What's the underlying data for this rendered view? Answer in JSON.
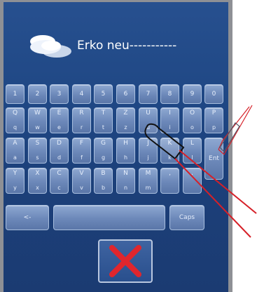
{
  "title": "Erko neu-----------",
  "keyboard": {
    "row_numbers": [
      "1",
      "2",
      "3",
      "4",
      "5",
      "6",
      "7",
      "8",
      "9",
      "0"
    ],
    "row_qwertz": [
      {
        "u": "Q",
        "l": "q"
      },
      {
        "u": "W",
        "l": "w"
      },
      {
        "u": "E",
        "l": "e"
      },
      {
        "u": "R",
        "l": "r"
      },
      {
        "u": "T",
        "l": "t"
      },
      {
        "u": "Z",
        "l": "z"
      },
      {
        "u": "U",
        "l": "u"
      },
      {
        "u": "I",
        "l": "i"
      },
      {
        "u": "O",
        "l": "o"
      },
      {
        "u": "P",
        "l": "p"
      }
    ],
    "row_asdf": [
      {
        "u": "A",
        "l": "a"
      },
      {
        "u": "S",
        "l": "s"
      },
      {
        "u": "D",
        "l": "d"
      },
      {
        "u": "F",
        "l": "f"
      },
      {
        "u": "G",
        "l": "g"
      },
      {
        "u": "H",
        "l": "h"
      },
      {
        "u": "J",
        "l": "j"
      },
      {
        "u": "K",
        "l": "k"
      },
      {
        "u": "L",
        "l": "l"
      }
    ],
    "enter_label": "Ent",
    "row_yxcv": [
      {
        "u": "Y",
        "l": "y"
      },
      {
        "u": "X",
        "l": "x"
      },
      {
        "u": "C",
        "l": "c"
      },
      {
        "u": "V",
        "l": "v"
      },
      {
        "u": "B",
        "l": "b"
      },
      {
        "u": "N",
        "l": "n"
      },
      {
        "u": "M",
        "l": "m"
      },
      {
        "u": ",",
        "l": ""
      },
      {
        "u": ".",
        "l": ""
      }
    ],
    "back_label": "<-",
    "caps_label": "Caps"
  },
  "colors": {
    "screen": "#1f4784",
    "key": "#7893c3",
    "cancel_x": "#e0262d",
    "stylus": "#e01b24"
  },
  "icons": {
    "logo": "clouds-logo-icon",
    "cancel": "cancel-x-icon",
    "stylus": "stylus-pen-icon"
  }
}
